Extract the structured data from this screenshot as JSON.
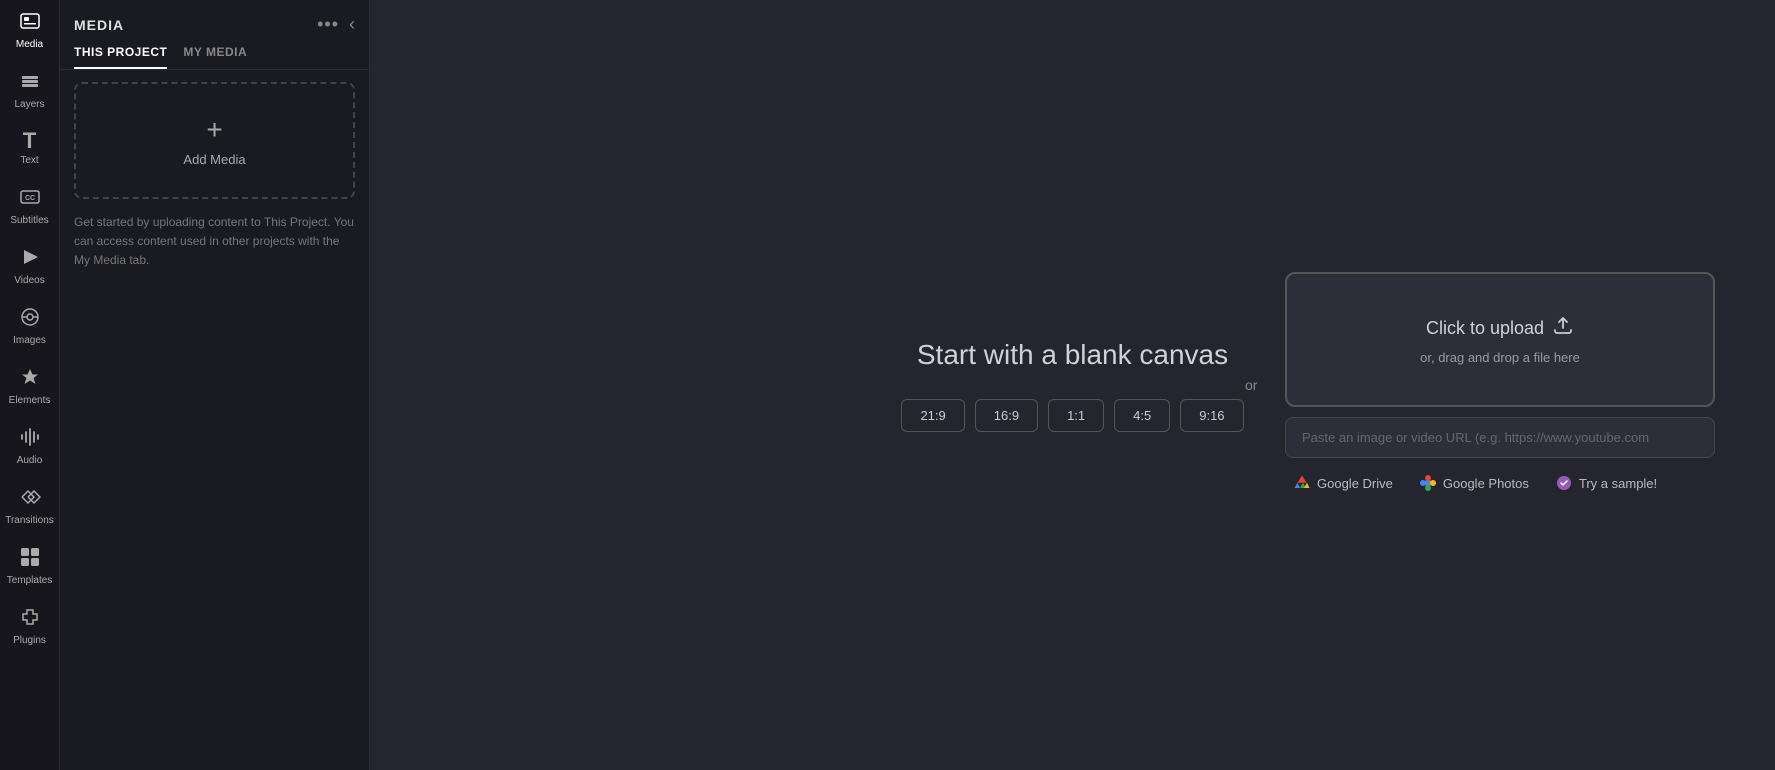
{
  "sidebar": {
    "items": [
      {
        "id": "media",
        "label": "Media",
        "icon": "🎬",
        "active": true
      },
      {
        "id": "layers",
        "label": "Layers",
        "icon": "⧉"
      },
      {
        "id": "text",
        "label": "Text",
        "icon": "T"
      },
      {
        "id": "subtitles",
        "label": "Subtitles",
        "icon": "CC"
      },
      {
        "id": "videos",
        "label": "Videos",
        "icon": "▷"
      },
      {
        "id": "images",
        "label": "Images",
        "icon": "🔍"
      },
      {
        "id": "elements",
        "label": "Elements",
        "icon": "✦"
      },
      {
        "id": "audio",
        "label": "Audio",
        "icon": "♪"
      },
      {
        "id": "transitions",
        "label": "Transitions",
        "icon": "⇄"
      },
      {
        "id": "templates",
        "label": "Templates",
        "icon": "⊞"
      },
      {
        "id": "plugins",
        "label": "Plugins",
        "icon": "⚙"
      }
    ]
  },
  "media_panel": {
    "title": "MEDIA",
    "tabs": [
      {
        "id": "this-project",
        "label": "THIS PROJECT",
        "active": true
      },
      {
        "id": "my-media",
        "label": "MY MEDIA",
        "active": false
      }
    ],
    "add_media_label": "Add Media",
    "hint_text": "Get started by uploading content to This Project. You can access content used in other projects with the My Media tab."
  },
  "canvas": {
    "title": "Start with a blank canvas",
    "ratios": [
      "21:9",
      "16:9",
      "1:1",
      "4:5",
      "9:16"
    ]
  },
  "upload": {
    "or_label": "or",
    "click_to_upload": "Click to upload",
    "drag_drop_text": "or, drag and drop a file here",
    "url_placeholder": "Paste an image or video URL (e.g. https://www.youtube.com",
    "google_drive_label": "Google Drive",
    "google_photos_label": "Google Photos",
    "try_sample_label": "Try a sample!"
  }
}
